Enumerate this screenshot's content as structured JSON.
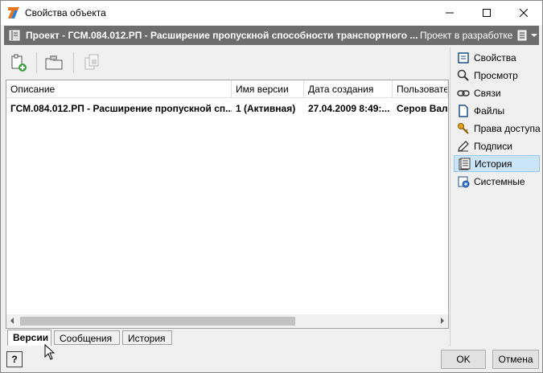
{
  "window": {
    "title": "Свойства объекта"
  },
  "object_bar": {
    "title": "Проект - ГСМ.084.012.РП - Расширение пропускной способности транспортного ...",
    "state": "Проект в разработке"
  },
  "toolbar": {
    "icons": [
      "add-version-icon",
      "open-folder-icon",
      "copy-version-icon"
    ]
  },
  "grid": {
    "columns": [
      "Описание",
      "Имя версии",
      "Дата создания",
      "Пользовате"
    ],
    "rows": [
      [
        "ГСМ.084.012.РП - Расширение пропускной сп...",
        "1 (Активная)",
        "27.04.2009 8:49:...",
        "Серов Вале"
      ]
    ]
  },
  "tabs": [
    {
      "label": "Версии",
      "active": true
    },
    {
      "label": "Сообщения",
      "active": false
    },
    {
      "label": "История",
      "active": false
    }
  ],
  "nav": {
    "items": [
      {
        "label": "Свойства",
        "icon": "properties-icon",
        "selected": false
      },
      {
        "label": "Просмотр",
        "icon": "magnifier-icon",
        "selected": false
      },
      {
        "label": "Связи",
        "icon": "link-icon",
        "selected": false
      },
      {
        "label": "Файлы",
        "icon": "file-icon",
        "selected": false
      },
      {
        "label": "Права доступа",
        "icon": "key-icon",
        "selected": false
      },
      {
        "label": "Подписи",
        "icon": "pen-icon",
        "selected": false
      },
      {
        "label": "История",
        "icon": "history-icon",
        "selected": true
      },
      {
        "label": "Системные",
        "icon": "system-gear-icon",
        "selected": false
      }
    ]
  },
  "buttons": {
    "help": "?",
    "ok": "OK",
    "cancel": "Отмена"
  },
  "colors": {
    "object_bar": "#6d6d6d",
    "selected_nav": "#cce4f7"
  }
}
